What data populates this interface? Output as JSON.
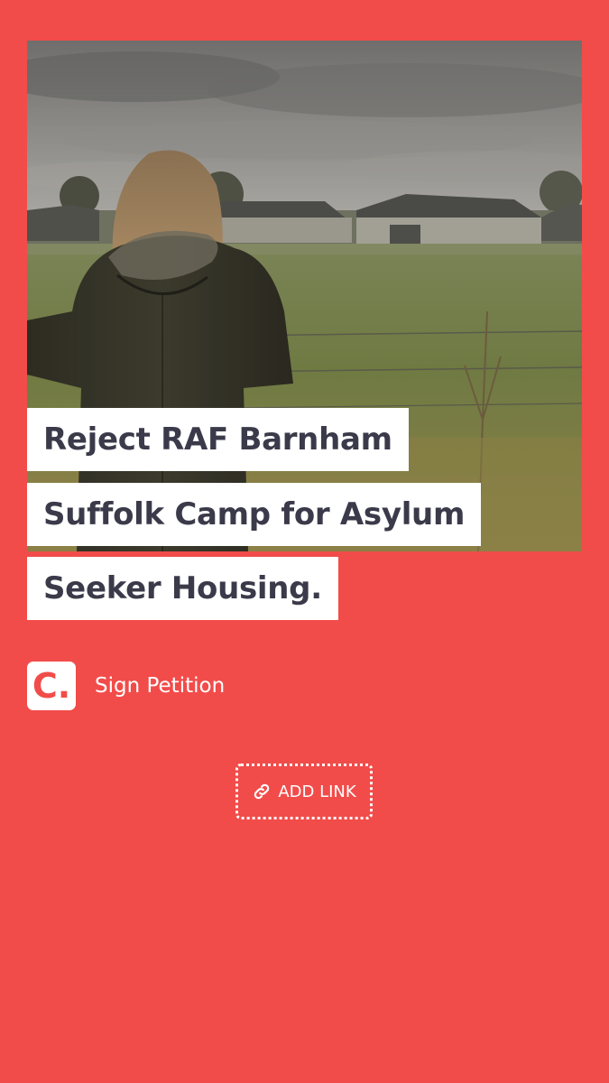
{
  "theme": {
    "background": "#f14c4a",
    "headline_bg": "#ffffff",
    "headline_text": "#3b3a4a",
    "brand_text": "#ffffff"
  },
  "photo": {
    "description_icon": "photo-icon"
  },
  "headline": {
    "lines": [
      "Reject RAF Barnham",
      "Suffolk Camp for Asylum",
      "Seeker Housing."
    ]
  },
  "brand": {
    "logo_glyph": "C.",
    "label": "Sign Petition"
  },
  "add_link": {
    "label": "ADD LINK",
    "icon": "link-icon"
  }
}
